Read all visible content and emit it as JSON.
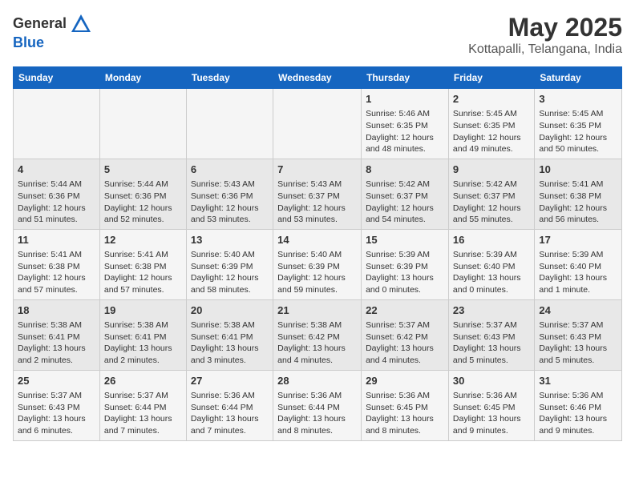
{
  "header": {
    "logo_general": "General",
    "logo_blue": "Blue",
    "month_year": "May 2025",
    "location": "Kottapalli, Telangana, India"
  },
  "days_of_week": [
    "Sunday",
    "Monday",
    "Tuesday",
    "Wednesday",
    "Thursday",
    "Friday",
    "Saturday"
  ],
  "weeks": [
    [
      {
        "day": "",
        "info": ""
      },
      {
        "day": "",
        "info": ""
      },
      {
        "day": "",
        "info": ""
      },
      {
        "day": "",
        "info": ""
      },
      {
        "day": "1",
        "info": "Sunrise: 5:46 AM\nSunset: 6:35 PM\nDaylight: 12 hours\nand 48 minutes."
      },
      {
        "day": "2",
        "info": "Sunrise: 5:45 AM\nSunset: 6:35 PM\nDaylight: 12 hours\nand 49 minutes."
      },
      {
        "day": "3",
        "info": "Sunrise: 5:45 AM\nSunset: 6:35 PM\nDaylight: 12 hours\nand 50 minutes."
      }
    ],
    [
      {
        "day": "4",
        "info": "Sunrise: 5:44 AM\nSunset: 6:36 PM\nDaylight: 12 hours\nand 51 minutes."
      },
      {
        "day": "5",
        "info": "Sunrise: 5:44 AM\nSunset: 6:36 PM\nDaylight: 12 hours\nand 52 minutes."
      },
      {
        "day": "6",
        "info": "Sunrise: 5:43 AM\nSunset: 6:36 PM\nDaylight: 12 hours\nand 53 minutes."
      },
      {
        "day": "7",
        "info": "Sunrise: 5:43 AM\nSunset: 6:37 PM\nDaylight: 12 hours\nand 53 minutes."
      },
      {
        "day": "8",
        "info": "Sunrise: 5:42 AM\nSunset: 6:37 PM\nDaylight: 12 hours\nand 54 minutes."
      },
      {
        "day": "9",
        "info": "Sunrise: 5:42 AM\nSunset: 6:37 PM\nDaylight: 12 hours\nand 55 minutes."
      },
      {
        "day": "10",
        "info": "Sunrise: 5:41 AM\nSunset: 6:38 PM\nDaylight: 12 hours\nand 56 minutes."
      }
    ],
    [
      {
        "day": "11",
        "info": "Sunrise: 5:41 AM\nSunset: 6:38 PM\nDaylight: 12 hours\nand 57 minutes."
      },
      {
        "day": "12",
        "info": "Sunrise: 5:41 AM\nSunset: 6:38 PM\nDaylight: 12 hours\nand 57 minutes."
      },
      {
        "day": "13",
        "info": "Sunrise: 5:40 AM\nSunset: 6:39 PM\nDaylight: 12 hours\nand 58 minutes."
      },
      {
        "day": "14",
        "info": "Sunrise: 5:40 AM\nSunset: 6:39 PM\nDaylight: 12 hours\nand 59 minutes."
      },
      {
        "day": "15",
        "info": "Sunrise: 5:39 AM\nSunset: 6:39 PM\nDaylight: 13 hours\nand 0 minutes."
      },
      {
        "day": "16",
        "info": "Sunrise: 5:39 AM\nSunset: 6:40 PM\nDaylight: 13 hours\nand 0 minutes."
      },
      {
        "day": "17",
        "info": "Sunrise: 5:39 AM\nSunset: 6:40 PM\nDaylight: 13 hours\nand 1 minute."
      }
    ],
    [
      {
        "day": "18",
        "info": "Sunrise: 5:38 AM\nSunset: 6:41 PM\nDaylight: 13 hours\nand 2 minutes."
      },
      {
        "day": "19",
        "info": "Sunrise: 5:38 AM\nSunset: 6:41 PM\nDaylight: 13 hours\nand 2 minutes."
      },
      {
        "day": "20",
        "info": "Sunrise: 5:38 AM\nSunset: 6:41 PM\nDaylight: 13 hours\nand 3 minutes."
      },
      {
        "day": "21",
        "info": "Sunrise: 5:38 AM\nSunset: 6:42 PM\nDaylight: 13 hours\nand 4 minutes."
      },
      {
        "day": "22",
        "info": "Sunrise: 5:37 AM\nSunset: 6:42 PM\nDaylight: 13 hours\nand 4 minutes."
      },
      {
        "day": "23",
        "info": "Sunrise: 5:37 AM\nSunset: 6:43 PM\nDaylight: 13 hours\nand 5 minutes."
      },
      {
        "day": "24",
        "info": "Sunrise: 5:37 AM\nSunset: 6:43 PM\nDaylight: 13 hours\nand 5 minutes."
      }
    ],
    [
      {
        "day": "25",
        "info": "Sunrise: 5:37 AM\nSunset: 6:43 PM\nDaylight: 13 hours\nand 6 minutes."
      },
      {
        "day": "26",
        "info": "Sunrise: 5:37 AM\nSunset: 6:44 PM\nDaylight: 13 hours\nand 7 minutes."
      },
      {
        "day": "27",
        "info": "Sunrise: 5:36 AM\nSunset: 6:44 PM\nDaylight: 13 hours\nand 7 minutes."
      },
      {
        "day": "28",
        "info": "Sunrise: 5:36 AM\nSunset: 6:44 PM\nDaylight: 13 hours\nand 8 minutes."
      },
      {
        "day": "29",
        "info": "Sunrise: 5:36 AM\nSunset: 6:45 PM\nDaylight: 13 hours\nand 8 minutes."
      },
      {
        "day": "30",
        "info": "Sunrise: 5:36 AM\nSunset: 6:45 PM\nDaylight: 13 hours\nand 9 minutes."
      },
      {
        "day": "31",
        "info": "Sunrise: 5:36 AM\nSunset: 6:46 PM\nDaylight: 13 hours\nand 9 minutes."
      }
    ]
  ]
}
